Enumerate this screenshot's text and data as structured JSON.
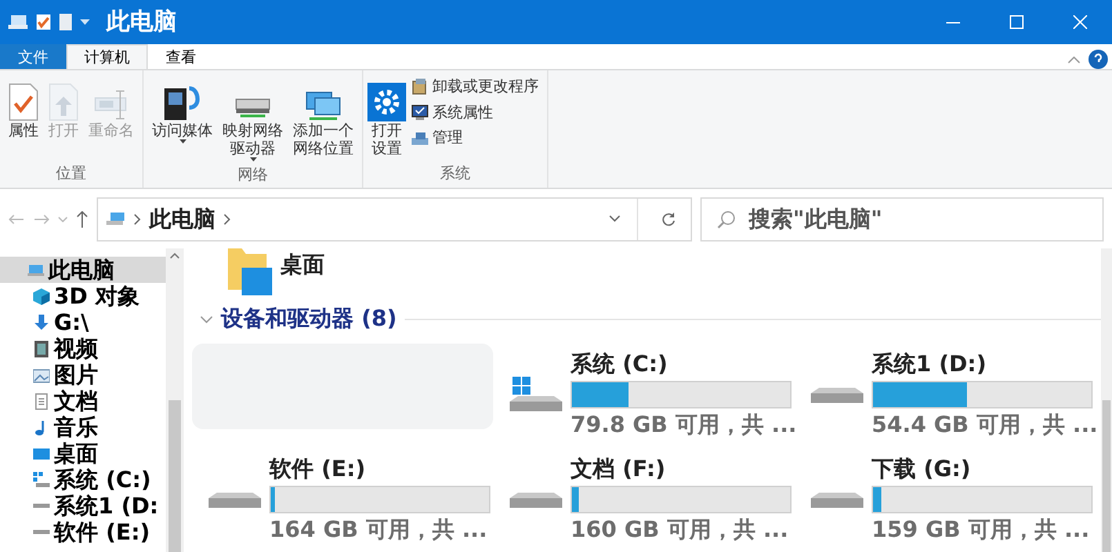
{
  "window": {
    "title": "此电脑"
  },
  "ribbon_tabs": [
    {
      "label": "文件",
      "kind": "file",
      "selected": false
    },
    {
      "label": "计算机",
      "kind": "tab",
      "selected": true
    },
    {
      "label": "查看",
      "kind": "tab",
      "selected": false
    }
  ],
  "ribbon_groups": [
    {
      "label": "位置",
      "items": [
        {
          "label": "属性",
          "kind": "large",
          "disabled": false,
          "dropdown": false
        },
        {
          "label": "打开",
          "kind": "large",
          "disabled": true,
          "dropdown": false
        },
        {
          "label": "重命名",
          "kind": "large",
          "disabled": true,
          "dropdown": false
        }
      ]
    },
    {
      "label": "网络",
      "items": [
        {
          "label": "访问媒体",
          "kind": "large",
          "disabled": false,
          "dropdown": true
        },
        {
          "label": "映射网络驱动器",
          "kind": "large",
          "disabled": false,
          "dropdown": true
        },
        {
          "label": "添加一个网络位置",
          "kind": "large",
          "disabled": false,
          "dropdown": false
        }
      ]
    },
    {
      "label": "系统",
      "items": [
        {
          "label": "打开设置",
          "kind": "large",
          "disabled": false,
          "dropdown": false
        },
        {
          "label": "卸载或更改程序",
          "kind": "small",
          "disabled": false,
          "dropdown": false
        },
        {
          "label": "系统属性",
          "kind": "small",
          "disabled": false,
          "dropdown": false
        },
        {
          "label": "管理",
          "kind": "small",
          "disabled": false,
          "dropdown": false
        }
      ]
    }
  ],
  "address_bar": {
    "path": [
      "此电脑"
    ]
  },
  "search": {
    "placeholder": "搜索\"此电脑\""
  },
  "sidebar": {
    "items": [
      {
        "label": "此电脑",
        "selected": true
      },
      {
        "label": "3D 对象",
        "selected": false
      },
      {
        "label": "G:\\",
        "selected": false
      },
      {
        "label": "视频",
        "selected": false
      },
      {
        "label": "图片",
        "selected": false
      },
      {
        "label": "文档",
        "selected": false
      },
      {
        "label": "音乐",
        "selected": false
      },
      {
        "label": "桌面",
        "selected": false
      },
      {
        "label": "系统 (C:)",
        "selected": false
      },
      {
        "label": "系统1 (D:",
        "selected": false
      },
      {
        "label": "软件 (E:)",
        "selected": false
      }
    ]
  },
  "folders": [
    {
      "label": "桌面"
    }
  ],
  "section": {
    "title": "设备和驱动器 (8)",
    "expanded": true
  },
  "drives": [
    {
      "kind": "blank"
    },
    {
      "kind": "system",
      "name": "系统 (C:)",
      "level": 0.26,
      "free": "79.8 GB 可用，共 ..."
    },
    {
      "kind": "disk",
      "name": "系统1 (D:)",
      "level": 0.43,
      "free": "54.4 GB 可用，共 ..."
    },
    {
      "kind": "disk",
      "name": "软件 (E:)",
      "level": 0.02,
      "free": "164 GB 可用，共 ..."
    },
    {
      "kind": "disk",
      "name": "文档 (F:)",
      "level": 0.03,
      "free": "160 GB 可用，共 ..."
    },
    {
      "kind": "disk",
      "name": "下载 (G:)",
      "level": 0.04,
      "free": "159 GB 可用，共 ..."
    }
  ]
}
